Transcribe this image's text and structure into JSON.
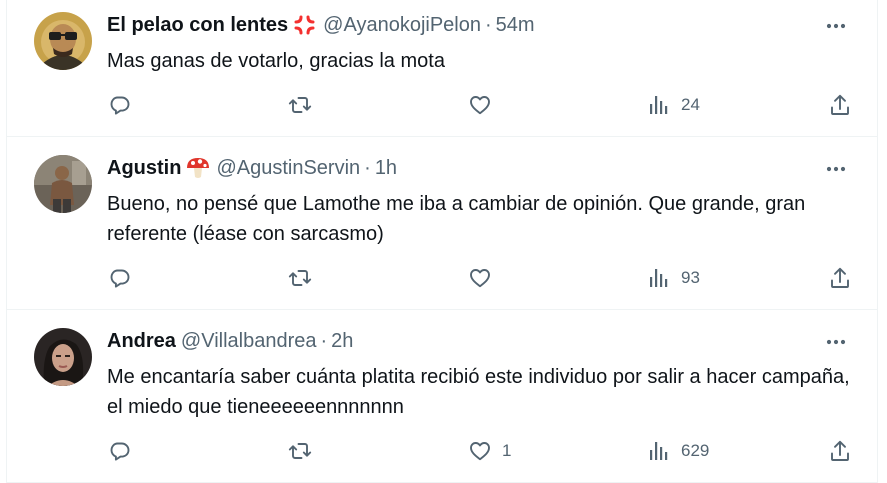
{
  "tweets": [
    {
      "name": "El pelao con lentes",
      "handle": "@AyanokojiPelon",
      "separator": "·",
      "time": "54m",
      "text": "Mas ganas de votarlo, gracias la mota",
      "likes": "",
      "views": "24",
      "name_emoji": "anger-emoji"
    },
    {
      "name": "Agustin",
      "handle": "@AgustinServin",
      "separator": "·",
      "time": "1h",
      "text": "Bueno, no pensé que Lamothe me iba a cambiar de opinión. Que grande, gran referente (léase con sarcasmo)",
      "likes": "",
      "views": "93",
      "name_emoji": "mushroom-emoji"
    },
    {
      "name": "Andrea",
      "handle": "@Villalbandrea",
      "separator": "·",
      "time": "2h",
      "text": "Me encantaría saber cuánta platita recibió este individuo por salir a hacer campaña, el miedo que tieneeeeeennnnnnn",
      "likes": "1",
      "views": "629"
    }
  ],
  "colors": {
    "text": "#0f1419",
    "secondary": "#536471",
    "border": "#eff3f4",
    "anger": "#f4302f",
    "mushroom": "#e0352b"
  },
  "icons": {
    "reply": "reply-icon",
    "retweet": "retweet-icon",
    "like": "heart-icon",
    "views": "views-icon",
    "share": "share-icon",
    "more": "more-icon"
  }
}
